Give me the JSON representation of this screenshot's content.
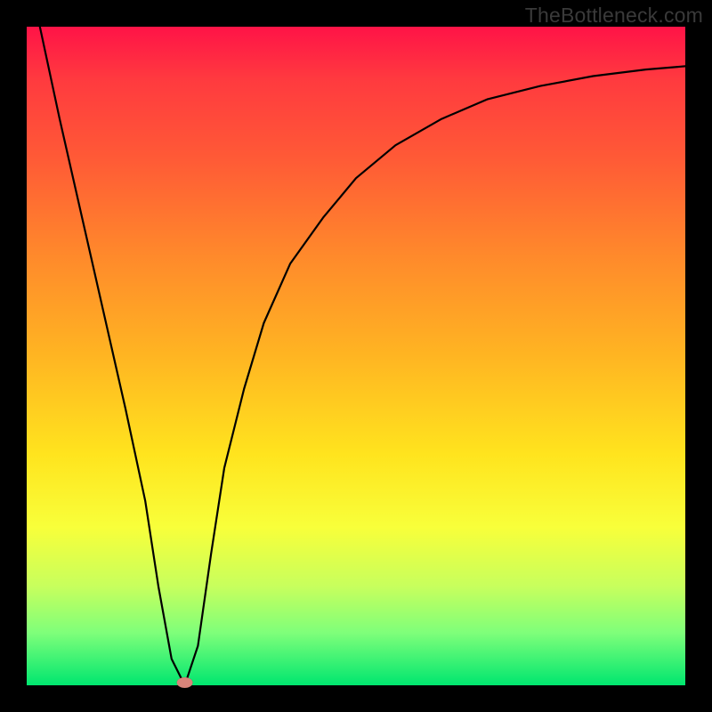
{
  "watermark": "TheBottleneck.com",
  "chart_data": {
    "type": "line",
    "title": "",
    "xlabel": "",
    "ylabel": "",
    "xlim": [
      0,
      100
    ],
    "ylim": [
      0,
      100
    ],
    "grid": false,
    "legend": false,
    "background_gradient": {
      "direction": "top-to-bottom",
      "stops": [
        {
          "pos": 0,
          "color": "#ff1347"
        },
        {
          "pos": 20,
          "color": "#ff5a36"
        },
        {
          "pos": 50,
          "color": "#ffb522"
        },
        {
          "pos": 76,
          "color": "#f8ff3a"
        },
        {
          "pos": 100,
          "color": "#00e66f"
        }
      ]
    },
    "series": [
      {
        "name": "bottleneck-curve",
        "x": [
          2,
          5,
          10,
          15,
          18,
          20,
          22,
          24,
          26,
          28,
          30,
          33,
          36,
          40,
          45,
          50,
          56,
          63,
          70,
          78,
          86,
          94,
          100
        ],
        "y": [
          100,
          86,
          64,
          42,
          28,
          15,
          4,
          0,
          6,
          20,
          33,
          45,
          55,
          64,
          71,
          77,
          82,
          86,
          89,
          91,
          92.5,
          93.5,
          94
        ]
      }
    ],
    "marker": {
      "name": "optimal-point",
      "x": 24,
      "y": 0,
      "shape": "ellipse",
      "fill": "#d8847a"
    }
  }
}
